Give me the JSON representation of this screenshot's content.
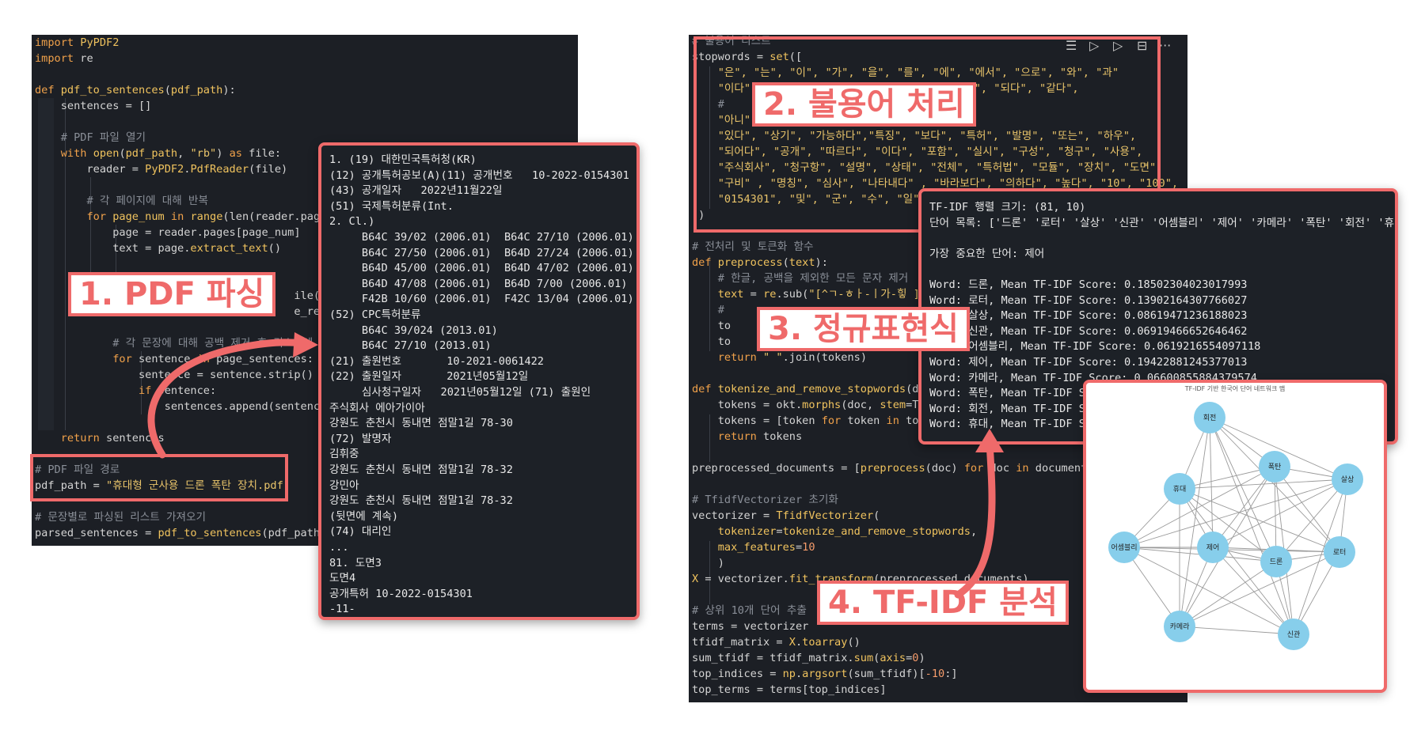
{
  "left_editor": {
    "lines": [
      [
        [
          "kw",
          "import"
        ],
        [
          "txt",
          " "
        ],
        [
          "fn",
          "PyPDF2"
        ]
      ],
      [
        [
          "kw",
          "import"
        ],
        [
          "txt",
          " re"
        ]
      ],
      [],
      [
        [
          "kw",
          "def"
        ],
        [
          "txt",
          " "
        ],
        [
          "fn",
          "pdf_to_sentences"
        ],
        [
          "txt",
          "("
        ],
        [
          "fn",
          "pdf_path"
        ],
        [
          "txt",
          "):"
        ]
      ],
      [
        [
          "txt",
          "    sentences = []"
        ]
      ],
      [],
      [
        [
          "cm",
          "    # PDF 파일 열기"
        ]
      ],
      [
        [
          "txt",
          "    "
        ],
        [
          "kw",
          "with"
        ],
        [
          "txt",
          " "
        ],
        [
          "fn",
          "open"
        ],
        [
          "txt",
          "("
        ],
        [
          "fn",
          "pdf_path"
        ],
        [
          "txt",
          ", "
        ],
        [
          "str",
          "\"rb\""
        ],
        [
          "txt",
          ") "
        ],
        [
          "kw",
          "as"
        ],
        [
          "txt",
          " file:"
        ]
      ],
      [
        [
          "txt",
          "        reader = "
        ],
        [
          "fn",
          "PyPDF2"
        ],
        [
          "txt",
          "."
        ],
        [
          "fn",
          "PdfReader"
        ],
        [
          "txt",
          "(file)"
        ]
      ],
      [],
      [
        [
          "cm",
          "        # 각 페이지에 대해 반복"
        ]
      ],
      [
        [
          "txt",
          "        "
        ],
        [
          "kw",
          "for"
        ],
        [
          "txt",
          " "
        ],
        [
          "fn",
          "page_num"
        ],
        [
          "txt",
          " "
        ],
        [
          "kw",
          "in"
        ],
        [
          "txt",
          " "
        ],
        [
          "fn",
          "range"
        ],
        [
          "txt",
          "(len(reader.page"
        ]
      ],
      [
        [
          "txt",
          "            page = reader.pages[page_num]"
        ]
      ],
      [
        [
          "txt",
          "            text = page."
        ],
        [
          "fn",
          "extract_text"
        ],
        [
          "txt",
          "()"
        ]
      ],
      [],
      [],
      [
        [
          "txt",
          "                                        ile(r'(?<"
        ]
      ],
      [
        [
          "txt",
          "                                        e_regex.s"
        ]
      ],
      [],
      [
        [
          "cm",
          "            # 각 문장에 대해 공백 제거 후 리스트에 추가"
        ]
      ],
      [
        [
          "txt",
          "            "
        ],
        [
          "kw",
          "for"
        ],
        [
          "txt",
          " sentence "
        ],
        [
          "kw",
          "in"
        ],
        [
          "txt",
          " page_sentences:"
        ]
      ],
      [
        [
          "txt",
          "                sentence = sentence.strip()"
        ]
      ],
      [
        [
          "txt",
          "                "
        ],
        [
          "kw",
          "if"
        ],
        [
          "txt",
          " sentence:"
        ]
      ],
      [
        [
          "txt",
          "                    sentences.append(sentence"
        ]
      ],
      [],
      [
        [
          "txt",
          "    "
        ],
        [
          "kw",
          "return"
        ],
        [
          "txt",
          " sentences"
        ]
      ],
      [],
      [
        [
          "cm",
          "# PDF 파일 경로"
        ]
      ],
      [
        [
          "txt",
          "pdf_path = "
        ],
        [
          "str",
          "\"휴대형 군사용 드론 폭탄 장치.pdf\""
        ]
      ],
      [],
      [
        [
          "cm",
          "# 문장별로 파싱된 리스트 가져오기"
        ]
      ],
      [
        [
          "txt",
          "parsed_sentences = "
        ],
        [
          "fn",
          "pdf_to_sentences"
        ],
        [
          "txt",
          "(pdf_path)"
        ]
      ]
    ]
  },
  "pdf_output": {
    "lines": [
      "1. (19) 대한민국특허청(KR)",
      "(12) 공개특허공보(A)(11) 공개번호   10-2022-0154301",
      "(43) 공개일자   2022년11월22일",
      "(51) 국제특허분류(Int.",
      "2. Cl.)",
      "     B64C 39/02 (2006.01)  B64C 27/10 (2006.01)",
      "     B64C 27/50 (2006.01)  B64D 27/24 (2006.01)",
      "     B64D 45/00 (2006.01)  B64D 47/02 (2006.01)",
      "     B64D 47/08 (2006.01)  B64D 7/00 (2006.01)",
      "     F42B 10/60 (2006.01)  F42C 13/04 (2006.01)",
      "(52) CPC특허분류",
      "     B64C 39/024 (2013.01)",
      "     B64C 27/10 (2013.01)",
      "(21) 출원번호       10-2021-0061422",
      "(22) 출원일자       2021년05월12일",
      "     심사청구일자   2021년05월12일 (71) 출원인",
      "주식회사 에아가이아",
      "강원도 춘천시 동내면 점말1길 78-30",
      "(72) 발명자",
      "김휘중",
      "강원도 춘천시 동내면 점말1길 78-32",
      "강민아",
      "강원도 춘천시 동내면 점말1길 78-32",
      "(뒷면에 계속)",
      "(74) 대리인",
      "...",
      "81. 도면3",
      "도면4",
      "공개특허 10-2022-0154301",
      "-11-"
    ]
  },
  "right_editor": {
    "lines": [
      [
        [
          "cm",
          "# 불용어 리스트"
        ]
      ],
      [
        [
          "txt",
          "stopwords = "
        ],
        [
          "fn",
          "set"
        ],
        [
          "txt",
          "(["
        ]
      ],
      [
        [
          "str",
          "    \"은\", \"는\", \"이\", \"가\", \"을\", \"를\", \"에\", \"에서\", \"으로\", \"와\", \"과\""
        ]
      ],
      [
        [
          "str",
          "    \"이다\""
        ],
        [
          "txt",
          "                                 "
        ],
        [
          "str",
          "다\", \"되다\", \"같다\","
        ]
      ],
      [
        [
          "cm",
          "    #"
        ]
      ],
      [
        [
          "str",
          "    \"아니\""
        ]
      ],
      [
        [
          "str",
          "    \"있다\", \"상기\", \"가능하다\",\"특징\", \"보다\", \"특허\", \"발명\", \"또는\", \"하우\","
        ]
      ],
      [
        [
          "str",
          "    \"되어다\", \"공개\", \"따르다\", \"이다\", \"포함\", \"실시\", \"구성\", \"청구\", \"사용\","
        ]
      ],
      [
        [
          "str",
          "    \"주식회사\", \"청구항\", \"설명\", \"상태\", \"전체\", \"특허법\", \"모듈\", \"장치\", \"도면\","
        ]
      ],
      [
        [
          "str",
          "    \"구비\" , \"명칭\", \"심사\", \"나타내다\" , \"바라보다\", \"의하다\", \"높다\", \"10\", \"100\","
        ]
      ],
      [
        [
          "str",
          "    \"0154301\", \"및\", \"군\", \"수\", \"일\""
        ]
      ],
      [
        [
          "txt",
          "])"
        ]
      ],
      [],
      [
        [
          "cm",
          "# 전처리 및 토큰화 함수"
        ]
      ],
      [
        [
          "kw",
          "def"
        ],
        [
          "txt",
          " "
        ],
        [
          "fn",
          "preprocess"
        ],
        [
          "txt",
          "("
        ],
        [
          "fn",
          "text"
        ],
        [
          "txt",
          "):"
        ]
      ],
      [
        [
          "cm",
          "    # 한글, 공백을 제외한 모든 문자 제거"
        ]
      ],
      [
        [
          "txt",
          "    "
        ],
        [
          "fn",
          "text"
        ],
        [
          "txt",
          " = "
        ],
        [
          "fn",
          "re"
        ],
        [
          "txt",
          ".sub("
        ],
        [
          "str",
          "\"[^ㄱ-ㅎㅏ-ㅣ가-힣 ]"
        ]
      ],
      [
        [
          "cm",
          "    #"
        ]
      ],
      [
        [
          "txt",
          "    to"
        ]
      ],
      [
        [
          "txt",
          "    to"
        ]
      ],
      [
        [
          "txt",
          "    "
        ],
        [
          "kw",
          "return"
        ],
        [
          "txt",
          " "
        ],
        [
          "str",
          "\" \""
        ],
        [
          "txt",
          ".join(tokens)"
        ]
      ],
      [],
      [
        [
          "kw",
          "def"
        ],
        [
          "txt",
          " "
        ],
        [
          "fn",
          "tokenize_and_remove_stopwords"
        ],
        [
          "txt",
          "(d"
        ]
      ],
      [
        [
          "txt",
          "    tokens = okt."
        ],
        [
          "fn",
          "morphs"
        ],
        [
          "txt",
          "(doc, "
        ],
        [
          "fn",
          "stem"
        ],
        [
          "txt",
          "=T"
        ]
      ],
      [
        [
          "txt",
          "    tokens = [token "
        ],
        [
          "kw",
          "for"
        ],
        [
          "txt",
          " token "
        ],
        [
          "kw",
          "in"
        ],
        [
          "txt",
          " to"
        ]
      ],
      [
        [
          "txt",
          "    "
        ],
        [
          "kw",
          "return"
        ],
        [
          "txt",
          " tokens"
        ]
      ],
      [],
      [
        [
          "txt",
          "preprocessed_documents = ["
        ],
        [
          "fn",
          "preprocess"
        ],
        [
          "txt",
          "(doc) "
        ],
        [
          "kw",
          "for"
        ],
        [
          "txt",
          " doc "
        ],
        [
          "kw",
          "in"
        ],
        [
          "txt",
          " document"
        ]
      ],
      [],
      [
        [
          "cm",
          "# TfidfVectorizer 초기화"
        ]
      ],
      [
        [
          "txt",
          "vectorizer = "
        ],
        [
          "fn",
          "TfidfVectorizer"
        ],
        [
          "txt",
          "("
        ]
      ],
      [
        [
          "txt",
          "    "
        ],
        [
          "fn",
          "tokenizer"
        ],
        [
          "txt",
          "="
        ],
        [
          "fn",
          "tokenize_and_remove_stopwords"
        ],
        [
          "txt",
          ","
        ]
      ],
      [
        [
          "txt",
          "    "
        ],
        [
          "fn",
          "max_features"
        ],
        [
          "txt",
          "="
        ],
        [
          "num",
          "10"
        ]
      ],
      [
        [
          "txt",
          "    )"
        ]
      ],
      [
        [
          "fn",
          "X"
        ],
        [
          "txt",
          " = vectorizer."
        ],
        [
          "fn",
          "fit_transform"
        ],
        [
          "txt",
          "(preprocessed_documents)"
        ]
      ],
      [],
      [
        [
          "cm",
          "# 상위 10개 단어 추출"
        ]
      ],
      [
        [
          "txt",
          "terms = vectorizer"
        ]
      ],
      [
        [
          "txt",
          "tfidf_matrix = "
        ],
        [
          "fn",
          "X"
        ],
        [
          "txt",
          "."
        ],
        [
          "fn",
          "toarray"
        ],
        [
          "txt",
          "()"
        ]
      ],
      [
        [
          "txt",
          "sum_tfidf = tfidf_matrix."
        ],
        [
          "fn",
          "sum"
        ],
        [
          "txt",
          "("
        ],
        [
          "fn",
          "axis"
        ],
        [
          "txt",
          "="
        ],
        [
          "num",
          "0"
        ],
        [
          "txt",
          ")"
        ]
      ],
      [
        [
          "txt",
          "top_indices = "
        ],
        [
          "fn",
          "np"
        ],
        [
          "txt",
          "."
        ],
        [
          "fn",
          "argsort"
        ],
        [
          "txt",
          "(sum_tfidf)["
        ],
        [
          "num",
          "-10"
        ],
        [
          "txt",
          ":]"
        ]
      ],
      [
        [
          "txt",
          "top_terms = terms[top_indices]"
        ]
      ]
    ]
  },
  "tfidf_output": {
    "lines": [
      "TF-IDF 행렬 크기: (81, 10)",
      "단어 목록: ['드론' '로터' '살상' '신관' '어셈블리' '제어' '카메라' '폭탄' '회전' '휴대']",
      "",
      "가장 중요한 단어: 제어",
      "",
      "Word: 드론, Mean TF-IDF Score: 0.18502304023017993",
      "Word: 로터, Mean TF-IDF Score: 0.13902164307766027",
      "Word: 살상, Mean TF-IDF Score: 0.08619471236188023",
      "Word: 신관, Mean TF-IDF Score: 0.06919466652646462",
      "Word: 어셈블리, Mean TF-IDF Score: 0.0619216554097118",
      "Word: 제어, Mean TF-IDF Score: 0.19422881245377013",
      "Word: 카메라, Mean TF-IDF Score: 0.06600855884379574",
      "Word: 폭탄, Mean TF-IDF Sc",
      "Word: 회전, Mean TF-IDF Sc",
      "Word: 휴대, Mean TF-IDF Sc"
    ]
  },
  "labels": {
    "step1": "1. PDF 파싱",
    "step2": "2. 불용어 처리",
    "step3": "3. 정규표현식",
    "step4": "4. TF-IDF 분석"
  },
  "graph": {
    "title": "TF-IDF 기반 한국어 단어 네트워크 맵",
    "nodes": [
      {
        "label": "회전"
      },
      {
        "label": "폭탄"
      },
      {
        "label": "휴대"
      },
      {
        "label": "살상"
      },
      {
        "label": "어셈블리"
      },
      {
        "label": "제어"
      },
      {
        "label": "드론"
      },
      {
        "label": "로터"
      },
      {
        "label": "카메라"
      },
      {
        "label": "신관"
      }
    ]
  },
  "toolbar": {
    "icons": [
      "list-run-icon",
      "run-above-icon",
      "run-below-icon",
      "split-icon",
      "more-icon"
    ],
    "more_label": "···"
  },
  "colors": {
    "accent": "#ef6a6a",
    "editor_bg": "#1c1f25",
    "node": "#87ceeb"
  }
}
